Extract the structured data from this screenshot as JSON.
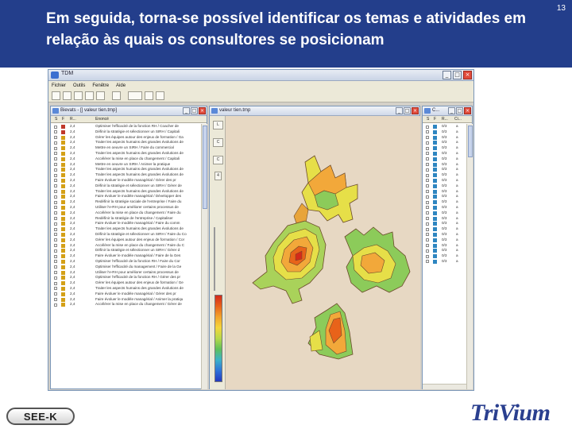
{
  "slide": {
    "title": "Em seguida, torna-se possível identificar os temas e atividades em relação às quais os consultores se posicionam",
    "page_number": "13"
  },
  "app": {
    "title": "TDM",
    "menu": [
      "Fichier",
      "Outils",
      "Fenêtre",
      "Aide"
    ],
    "window_buttons": {
      "minimize": "_",
      "maximize": "□",
      "close": "×"
    },
    "colors": {
      "header": "#233e8b",
      "map_bg": "#e7d8c3"
    }
  },
  "left_window": {
    "title": "Bievats - [] valeur tien.tmp]",
    "columns": [
      "S",
      "F",
      "R...",
      "Enoncé"
    ],
    "rows": [
      {
        "flag": "#c0392b",
        "r": "2,4",
        "text": "Optimiser l'efficacité de la fonction RH / Coacher de"
      },
      {
        "flag": "#c0392b",
        "r": "2,4",
        "text": "Définir la stratégie et sélectionner un SIRH / Capitali"
      },
      {
        "flag": "#d4a017",
        "r": "2,4",
        "text": "Gérer les équipes autour des enjeux de formation / Ga"
      },
      {
        "flag": "#d4a017",
        "r": "2,4",
        "text": "Traiter les aspects humains des grandes évolutions de"
      },
      {
        "flag": "#d4a017",
        "r": "2,4",
        "text": "Mettre en oeuvre un SIRH / Faire du commercial"
      },
      {
        "flag": "#d4a017",
        "r": "2,4",
        "text": "Traiter les aspects humains des grandes évolutions de"
      },
      {
        "flag": "#d4a017",
        "r": "2,4",
        "text": "Accélérer la mise en place du changement / Capitali"
      },
      {
        "flag": "#d4a017",
        "r": "2,4",
        "text": "Mettre en oeuvre un SIRH / Animer la pratique"
      },
      {
        "flag": "#d4a017",
        "r": "2,4",
        "text": "Traiter les aspects humains des grandes évolutions de"
      },
      {
        "flag": "#d4a017",
        "r": "2,4",
        "text": "Traiter les aspects humains des grandes évolutions de"
      },
      {
        "flag": "#d4a017",
        "r": "2,4",
        "text": "Faire évoluer le modèle managérial / Gérer des pr"
      },
      {
        "flag": "#d4a017",
        "r": "2,4",
        "text": "Définir la stratégie et sélectionner un SIRH / Gérer de"
      },
      {
        "flag": "#d4a017",
        "r": "2,4",
        "text": "Traiter les aspects humains des grandes évolutions de"
      },
      {
        "flag": "#d4a017",
        "r": "2,4",
        "text": "Faire évoluer le modèle managérial / Développer des"
      },
      {
        "flag": "#d4a017",
        "r": "2,4",
        "text": "Redéfinir la stratégie sociale de l'entreprise / Faire du"
      },
      {
        "flag": "#d4a017",
        "r": "2,4",
        "text": "Utiliser l'e-RH pour améliorer certains processus de"
      },
      {
        "flag": "#d4a017",
        "r": "2,4",
        "text": "Accélérer la mise en place du changement / Faire du"
      },
      {
        "flag": "#d4a017",
        "r": "2,4",
        "text": "Redéfinir la stratégie de l'entreprise / Capitaliser"
      },
      {
        "flag": "#d4a017",
        "r": "2,4",
        "text": "Faire évoluer le modèle managérial / Faire du comm"
      },
      {
        "flag": "#d4a017",
        "r": "2,4",
        "text": "Traiter les aspects humains des grandes évolutions de"
      },
      {
        "flag": "#d4a017",
        "r": "2,4",
        "text": "Définir la stratégie et sélectionner un SIRH / Faire du Co"
      },
      {
        "flag": "#d4a017",
        "r": "2,4",
        "text": "Gérer les équipes autour des enjeux de formation / Cor"
      },
      {
        "flag": "#d4a017",
        "r": "2,4",
        "text": "Accélérer la mise en place du changement / Faire du C"
      },
      {
        "flag": "#d4a017",
        "r": "2,4",
        "text": "Définir la stratégie et sélectionner un SIRH / Gérer d"
      },
      {
        "flag": "#d4a017",
        "r": "2,4",
        "text": "Faire évoluer le modèle managérial / Faire de la Ges"
      },
      {
        "flag": "#d4a017",
        "r": "2,4",
        "text": "Optimiser l'efficacité de la fonction RH / Faire du Cor"
      },
      {
        "flag": "#d4a017",
        "r": "2,4",
        "text": "Optimiser l'efficacité du management / Faire de la Ge"
      },
      {
        "flag": "#d4a017",
        "r": "2,4",
        "text": "Utiliser l'e-RH pour améliorer certains processus de"
      },
      {
        "flag": "#d4a017",
        "r": "2,4",
        "text": "Optimiser l'efficacité de la fonction RH / Gérer des pr"
      },
      {
        "flag": "#d4a017",
        "r": "2,4",
        "text": "Gérer les équipes autour des enjeux de formation / Ge"
      },
      {
        "flag": "#d4a017",
        "r": "2,4",
        "text": "Traiter les aspects humains des grandes évolutions de"
      },
      {
        "flag": "#d4a017",
        "r": "2,4",
        "text": "Faire évoluer le modèle managérial / Gérer des pr"
      },
      {
        "flag": "#d4a017",
        "r": "2,4",
        "text": "Faire évoluer le modèle managérial / Animer la pratiqu"
      },
      {
        "flag": "#d4a017",
        "r": "2,4",
        "text": "Accélérer la mise en place du changement / Gérer de"
      }
    ]
  },
  "map_window": {
    "title": "valeur tien.tmp",
    "palette_buttons": [
      "L",
      "C",
      "C",
      "4"
    ]
  },
  "right_window": {
    "title": "C...",
    "columns": [
      "S",
      "F",
      "R...",
      "Ci..."
    ],
    "rows": [
      {
        "flag": "#2e86c1",
        "r": "0/3",
        "c": "a"
      },
      {
        "flag": "#2e86c1",
        "r": "0/3",
        "c": "a"
      },
      {
        "flag": "#2e86c1",
        "r": "0/3",
        "c": "a"
      },
      {
        "flag": "#2e86c1",
        "r": "0/3",
        "c": "a"
      },
      {
        "flag": "#2e86c1",
        "r": "0/3",
        "c": "a"
      },
      {
        "flag": "#2e86c1",
        "r": "0/3",
        "c": "a"
      },
      {
        "flag": "#2e86c1",
        "r": "0/3",
        "c": "a"
      },
      {
        "flag": "#2e86c1",
        "r": "0/3",
        "c": "a"
      },
      {
        "flag": "#2e86c1",
        "r": "0/3",
        "c": "a"
      },
      {
        "flag": "#2e86c1",
        "r": "0/3",
        "c": "a"
      },
      {
        "flag": "#2e86c1",
        "r": "0/3",
        "c": "a"
      },
      {
        "flag": "#2e86c1",
        "r": "0/3",
        "c": "a"
      },
      {
        "flag": "#2e86c1",
        "r": "0/3",
        "c": "a"
      },
      {
        "flag": "#2e86c1",
        "r": "0/3",
        "c": "a"
      },
      {
        "flag": "#2e86c1",
        "r": "0/3",
        "c": "a"
      },
      {
        "flag": "#2e86c1",
        "r": "0/3",
        "c": "a"
      },
      {
        "flag": "#2e86c1",
        "r": "0/3",
        "c": "a"
      },
      {
        "flag": "#2e86c1",
        "r": "0/3",
        "c": "a"
      },
      {
        "flag": "#2e86c1",
        "r": "0/3",
        "c": "a"
      },
      {
        "flag": "#2e86c1",
        "r": "0/3",
        "c": "a"
      },
      {
        "flag": "#2e86c1",
        "r": "0/3",
        "c": "a"
      },
      {
        "flag": "#2e86c1",
        "r": "0/3",
        "c": "a"
      },
      {
        "flag": "#2e86c1",
        "r": "0/3",
        "c": "a"
      },
      {
        "flag": "#2e86c1",
        "r": "0/3",
        "c": "a"
      },
      {
        "flag": "#2e86c1",
        "r": "0/3",
        "c": "a"
      },
      {
        "flag": "#2e86c1",
        "r": "0/3",
        "c": "a"
      }
    ]
  },
  "footer": {
    "left_logo": "SEE-K",
    "right_logo": "TriVium"
  }
}
